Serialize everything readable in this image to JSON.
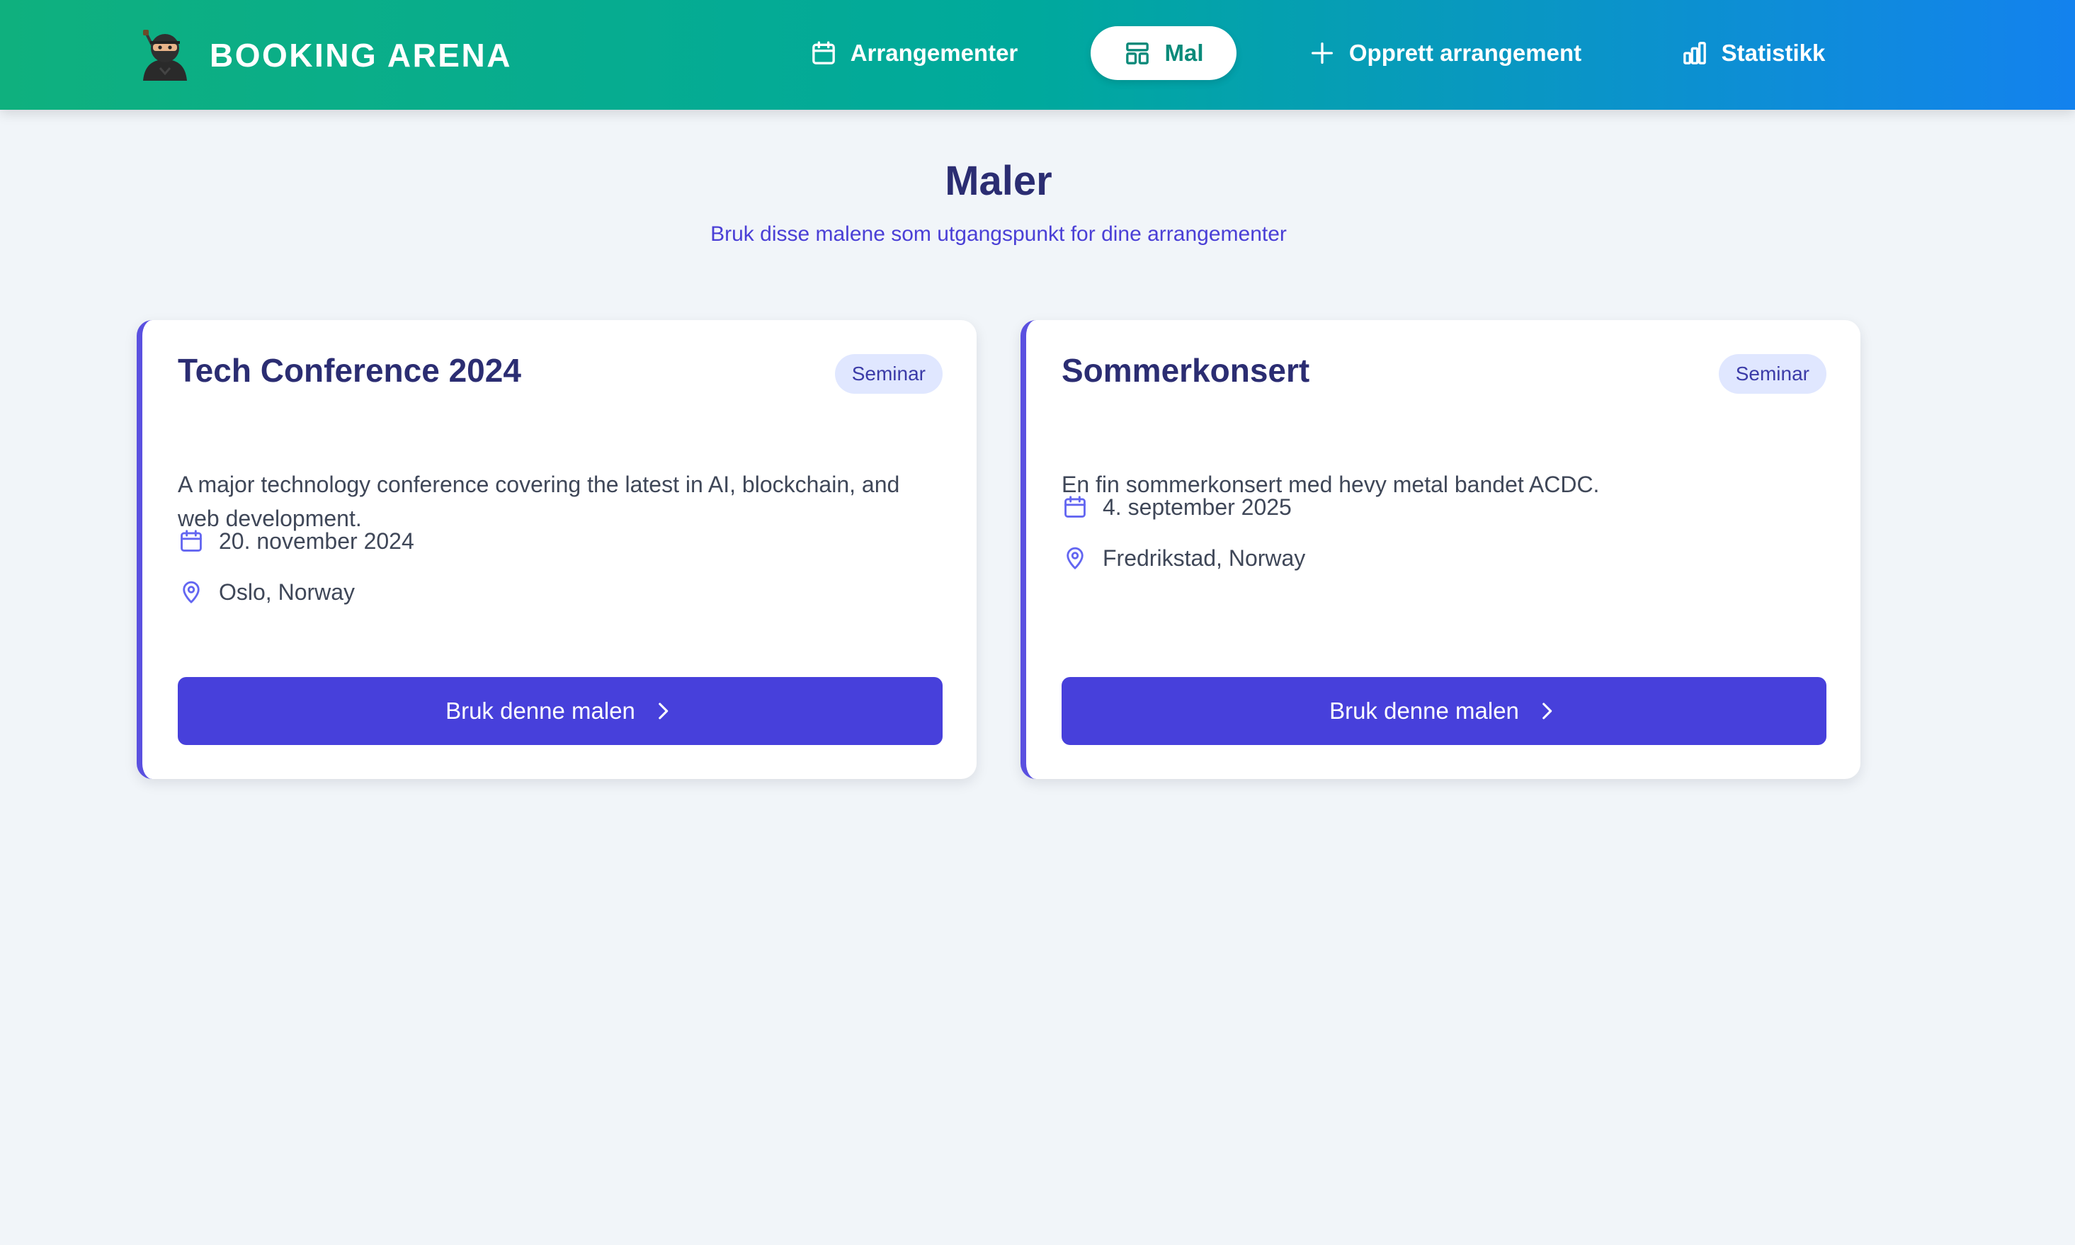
{
  "app": {
    "name": "BOOKING ARENA"
  },
  "nav": {
    "items": [
      {
        "label": "Arrangementer",
        "icon": "calendar-icon"
      },
      {
        "label": "Mal",
        "icon": "template-icon",
        "active": true
      },
      {
        "label": "Opprett arrangement",
        "icon": "plus-icon"
      },
      {
        "label": "Statistikk",
        "icon": "bar-chart-icon"
      }
    ]
  },
  "page": {
    "title": "Maler",
    "subtitle": "Bruk disse malene som utgangspunkt for dine arrangementer"
  },
  "templates": [
    {
      "title": "Tech Conference 2024",
      "badge": "Seminar",
      "description": "A major technology conference covering the latest in AI, blockchain, and web development.",
      "date": "20. november 2024",
      "location": "Oslo, Norway",
      "button": "Bruk denne malen"
    },
    {
      "title": "Sommerkonsert",
      "badge": "Seminar",
      "description": "En fin sommerkonsert med hevy metal bandet ACDC.",
      "date": "4. september 2025",
      "location": "Fredrikstad, Norway",
      "button": "Bruk denne malen"
    }
  ],
  "colors": {
    "nav_gradient_start": "#0fb07e",
    "nav_gradient_end": "#1382ee",
    "primary": "#4740db",
    "title": "#2b2d72",
    "badge_bg": "#e0e7ff"
  }
}
